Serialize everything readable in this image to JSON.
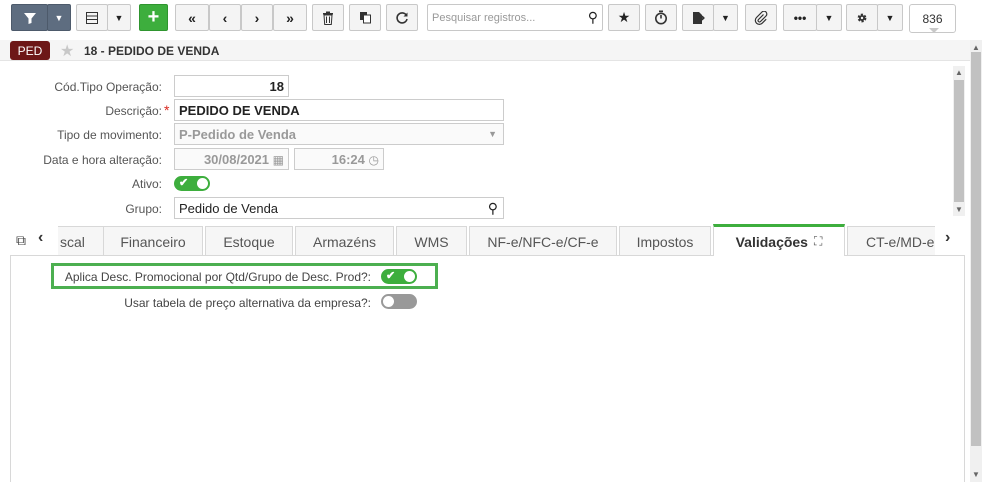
{
  "toolbar": {
    "filter_icon": "filter-icon",
    "grid_icon": "grid-icon",
    "add_label": "+",
    "search_placeholder": "Pesquisar registros...",
    "record_count": "836"
  },
  "header": {
    "badge": "PED",
    "title": "18 - PEDIDO DE VENDA"
  },
  "form": {
    "cod_tipo_label": "Cód.Tipo Operação:",
    "cod_tipo_value": "18",
    "descricao_label": "Descrição:",
    "descricao_value": "PEDIDO DE VENDA",
    "tipo_mov_label": "Tipo de movimento:",
    "tipo_mov_value": "P-Pedido de Venda",
    "data_label": "Data e hora alteração:",
    "data_value": "30/08/2021",
    "hora_value": "16:24",
    "ativo_label": "Ativo:",
    "ativo_on": true,
    "grupo_label": "Grupo:",
    "grupo_value": "Pedido de Venda"
  },
  "tabs": [
    "scal",
    "Financeiro",
    "Estoque",
    "Armazéns",
    "WMS",
    "NF-e/NFC-e/CF-e",
    "Impostos",
    "Validações",
    "CT-e/MD-e"
  ],
  "active_tab": "Validações",
  "validacoes": {
    "aplica_desc_label": "Aplica Desc. Promocional por Qtd/Grupo de Desc. Prod?:",
    "aplica_desc_on": true,
    "usar_tabela_label": "Usar tabela de preço alternativa da empresa?:",
    "usar_tabela_on": false
  },
  "colors": {
    "accent_green": "#3dae3d",
    "badge_red": "#6d1717",
    "toolbar_dark": "#5e6d80",
    "highlight": "#4caf50"
  }
}
